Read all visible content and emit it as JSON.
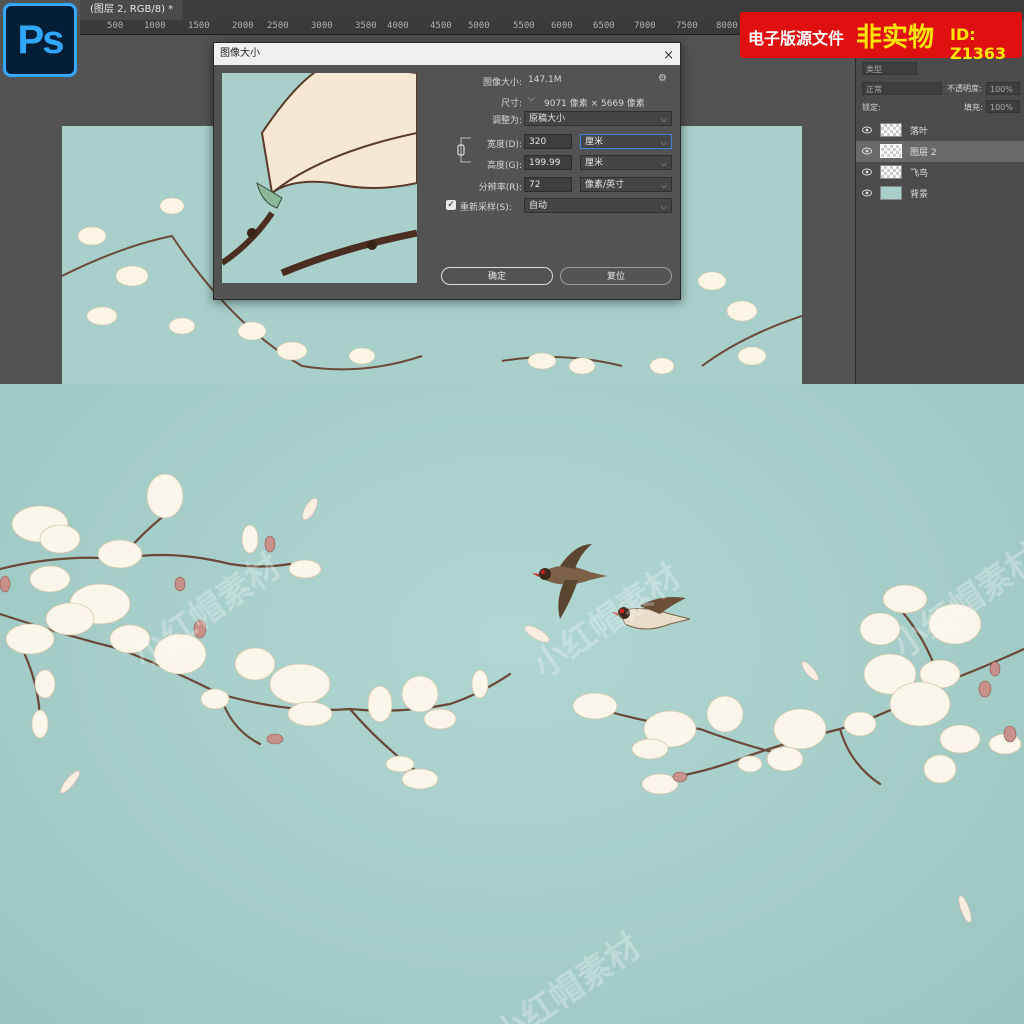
{
  "app": {
    "logo_text": "Ps",
    "doc_tab": "(图层 2, RGB/8) *",
    "ruler_ticks": [
      "500",
      "1000",
      "1500",
      "2000",
      "2500",
      "3000",
      "3500",
      "4000",
      "4500",
      "5000",
      "5500",
      "6000",
      "6500",
      "7000",
      "7500",
      "8000"
    ]
  },
  "banner": {
    "text1": "电子版源文件",
    "text2": "非实物",
    "text3": "ID: Z1363"
  },
  "layers_panel": {
    "filter_label": "类型",
    "blend_mode": "正常",
    "opacity_label": "不透明度:",
    "opacity_value": "100%",
    "lock_label": "锁定:",
    "fill_label": "填充:",
    "fill_value": "100%",
    "layers": [
      {
        "name": "落叶",
        "selected": false
      },
      {
        "name": "图层 2",
        "selected": true
      },
      {
        "name": "飞鸟",
        "selected": false
      },
      {
        "name": "背景",
        "selected": false
      }
    ]
  },
  "dialog": {
    "title": "图像大小",
    "close": "×",
    "image_size_label": "图像大小:",
    "image_size_value": "147.1M",
    "dimensions_label": "尺寸:",
    "dimensions_value": "9071 像素 × 5669 像素",
    "fit_label": "调整为:",
    "fit_value": "原稿大小",
    "width_label": "宽度(D):",
    "width_value": "320",
    "width_unit": "厘米",
    "height_label": "高度(G):",
    "height_value": "199.99",
    "height_unit": "厘米",
    "resolution_label": "分辨率(R):",
    "resolution_value": "72",
    "resolution_unit": "像素/英寸",
    "resample_label": "重新采样(S):",
    "resample_value": "自动",
    "ok_button": "确定",
    "reset_button": "复位"
  },
  "watermark": "小红帽素材",
  "colors": {
    "ps_blue": "#31a8ff",
    "banner_red": "#e01010",
    "banner_yellow": "#ffe600",
    "background_teal": "#a9cfca"
  }
}
